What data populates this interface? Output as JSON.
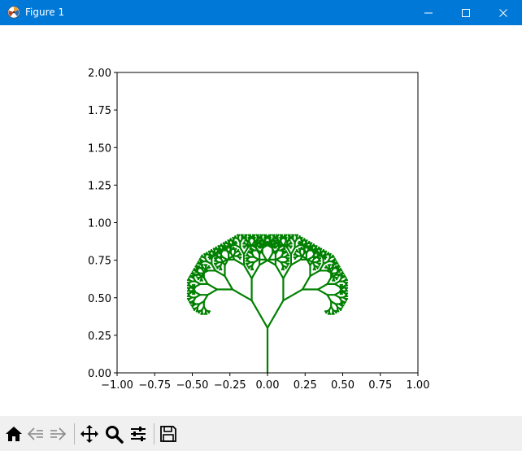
{
  "window": {
    "title": "Figure 1",
    "controls": [
      "minimize",
      "maximize",
      "close"
    ]
  },
  "toolbar": {
    "buttons": [
      {
        "name": "home",
        "icon": "home-icon"
      },
      {
        "name": "back",
        "icon": "back-arrow-icon"
      },
      {
        "name": "forward",
        "icon": "forward-arrow-icon"
      },
      {
        "name": "pan",
        "icon": "move-icon"
      },
      {
        "name": "zoom",
        "icon": "magnifier-icon"
      },
      {
        "name": "configure-subplots",
        "icon": "sliders-icon"
      },
      {
        "name": "save",
        "icon": "floppy-disk-icon"
      }
    ]
  },
  "chart_data": {
    "type": "line",
    "description_kind": "fractal tree",
    "title": "",
    "xlabel": "",
    "ylabel": "",
    "xlim": [
      -1.0,
      1.0
    ],
    "ylim": [
      0.0,
      2.0
    ],
    "xticks": [
      "−1.00",
      "−0.75",
      "−0.50",
      "−0.25",
      "0.00",
      "0.25",
      "0.50",
      "0.75",
      "1.00"
    ],
    "yticks": [
      "0.00",
      "0.25",
      "0.50",
      "0.75",
      "1.00",
      "1.25",
      "1.50",
      "1.75",
      "2.00"
    ],
    "grid": false,
    "color": "#008000",
    "tree": {
      "trunk_base": [
        0.0,
        0.0
      ],
      "trunk_length": 0.3,
      "branch_angle_deg": 30,
      "length_ratio": 0.7,
      "depth": 9
    }
  }
}
